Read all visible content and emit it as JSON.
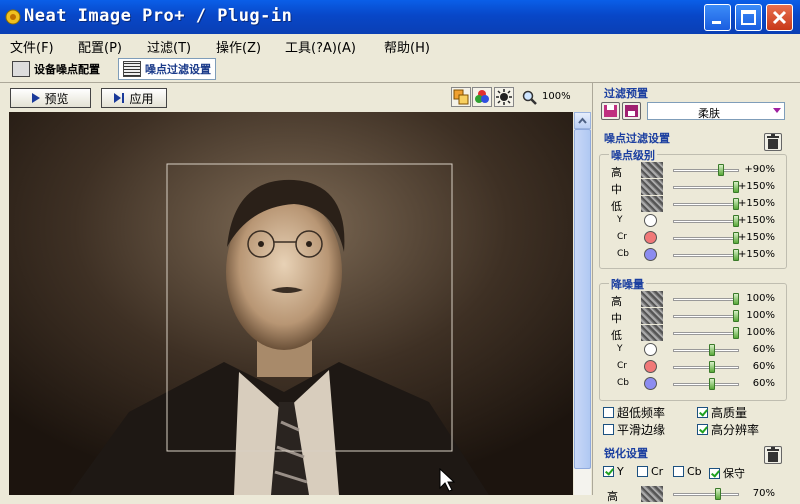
{
  "window": {
    "title": "Neat Image Pro+ / Plug-in"
  },
  "menu": [
    "文件(F)",
    "配置(P)",
    "过滤(T)",
    "操作(Z)",
    "工具(?A)(A)",
    "帮助(H)"
  ],
  "tabs": {
    "device": "设备噪点配置",
    "filter": "噪点过滤设置"
  },
  "toolbar": {
    "preview": "预览",
    "apply": "应用",
    "zoom": "100%"
  },
  "panel": {
    "preset_title": "过滤预置",
    "preset_value": "柔肤",
    "filter_settings_title": "噪点过滤设置",
    "noise_level_title": "噪点级别",
    "noise_level": [
      {
        "label": "高",
        "value": "+90%",
        "kind": "swatch",
        "pos": 0.75
      },
      {
        "label": "中",
        "value": "+150%",
        "kind": "swatch",
        "pos": 1.0
      },
      {
        "label": "低",
        "value": "+150%",
        "kind": "swatch",
        "pos": 1.0
      },
      {
        "label": "Y",
        "value": "+150%",
        "kind": "circle",
        "color": "#ffffff",
        "pos": 1.0
      },
      {
        "label": "Cr",
        "value": "+150%",
        "kind": "circle",
        "color": "#f07878",
        "pos": 1.0
      },
      {
        "label": "Cb",
        "value": "+150%",
        "kind": "circle",
        "color": "#8c8cf0",
        "pos": 1.0
      }
    ],
    "noise_reduction_title": "降噪量",
    "noise_reduction": [
      {
        "label": "高",
        "value": "100%",
        "kind": "swatch",
        "pos": 1.0
      },
      {
        "label": "中",
        "value": "100%",
        "kind": "swatch",
        "pos": 1.0
      },
      {
        "label": "低",
        "value": "100%",
        "kind": "swatch",
        "pos": 1.0
      },
      {
        "label": "Y",
        "value": "60%",
        "kind": "circle",
        "color": "#ffffff",
        "pos": 0.6
      },
      {
        "label": "Cr",
        "value": "60%",
        "kind": "circle",
        "color": "#f07878",
        "pos": 0.6
      },
      {
        "label": "Cb",
        "value": "60%",
        "kind": "circle",
        "color": "#8c8cf0",
        "pos": 0.6
      }
    ],
    "options": [
      {
        "label": "超低频率",
        "checked": false
      },
      {
        "label": "高质量",
        "checked": true
      },
      {
        "label": "平滑边缘",
        "checked": false
      },
      {
        "label": "高分辨率",
        "checked": true
      }
    ],
    "sharpen_title": "锐化设置",
    "sharpen_channels": [
      {
        "label": "Y",
        "checked": true
      },
      {
        "label": "Cr",
        "checked": false
      },
      {
        "label": "Cb",
        "checked": false
      },
      {
        "label": "保守",
        "checked": true
      }
    ],
    "sharpen_row": {
      "label": "高",
      "value": "70%",
      "pos": 0.7
    }
  }
}
